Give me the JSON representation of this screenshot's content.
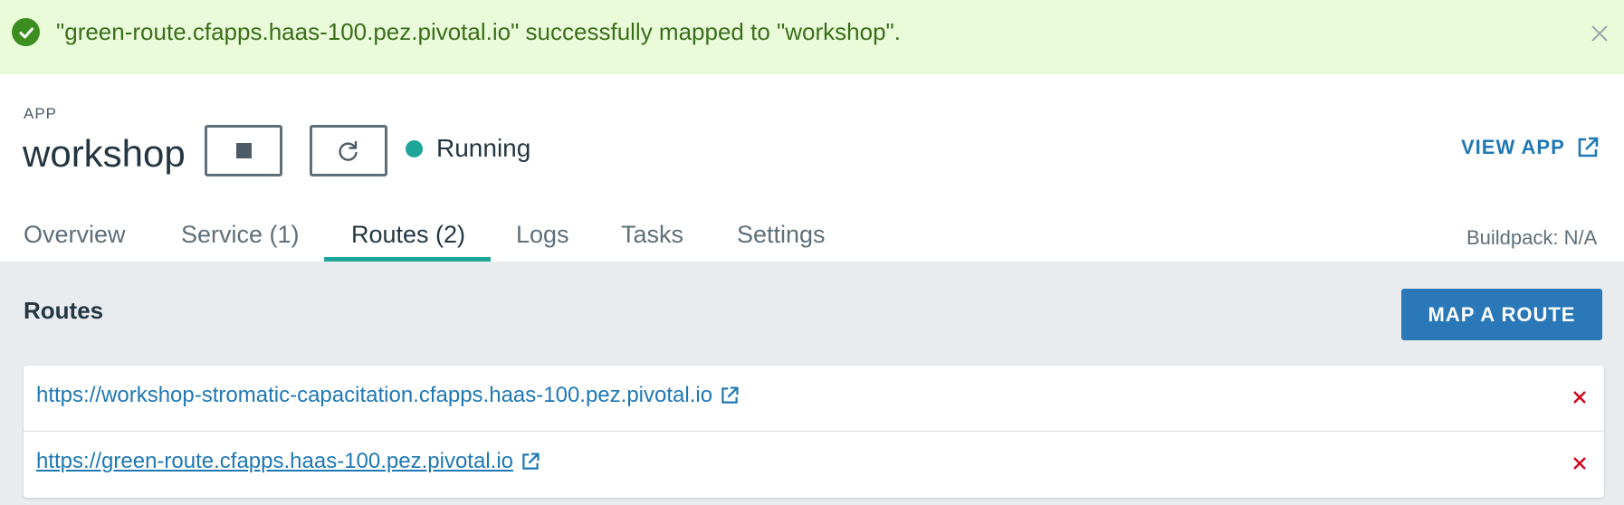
{
  "alert": {
    "message": "\"green-route.cfapps.haas-100.pez.pivotal.io\" successfully mapped to \"workshop\".",
    "background": "#e9fbd9",
    "icon": "check-circle-icon",
    "close_icon": "close-icon"
  },
  "app": {
    "label": "APP",
    "name": "workshop",
    "status": "Running",
    "status_color": "#1ea59a",
    "view_app_label": "VIEW APP"
  },
  "tabs": [
    {
      "label": "Overview",
      "active": false
    },
    {
      "label": "Service (1)",
      "active": false
    },
    {
      "label": "Routes (2)",
      "active": true
    },
    {
      "label": "Logs",
      "active": false
    },
    {
      "label": "Tasks",
      "active": false
    },
    {
      "label": "Settings",
      "active": false
    }
  ],
  "buildpack": "Buildpack: N/A",
  "routes": {
    "title": "Routes",
    "map_button": "MAP A ROUTE",
    "items": [
      {
        "url": "https://workshop-stromatic-capacitation.cfapps.haas-100.pez.pivotal.io"
      },
      {
        "url": "https://green-route.cfapps.haas-100.pez.pivotal.io"
      }
    ]
  },
  "colors": {
    "accent": "#1f78b4",
    "primary_button": "#2a78b8",
    "delete": "#d0021b",
    "tab_underline": "#1ea59a"
  }
}
